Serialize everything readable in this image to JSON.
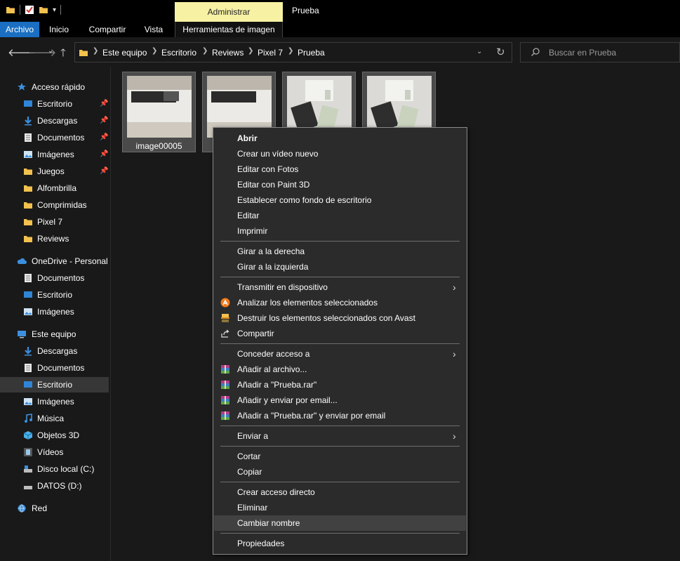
{
  "window": {
    "title": "Prueba",
    "contextual_tab": "Administrar"
  },
  "ribbon": {
    "tabs": [
      "Archivo",
      "Inicio",
      "Compartir",
      "Vista",
      "Herramientas de imagen"
    ]
  },
  "address": {
    "crumbs": [
      "Este equipo",
      "Escritorio",
      "Reviews",
      "Pixel 7",
      "Prueba"
    ]
  },
  "search": {
    "placeholder": "Buscar en Prueba"
  },
  "sidebar": {
    "quick_access": "Acceso rápido",
    "quick_items": [
      "Escritorio",
      "Descargas",
      "Documentos",
      "Imágenes",
      "Juegos",
      "Alfombrilla",
      "Comprimidas",
      "Pixel 7",
      "Reviews"
    ],
    "onedrive": "OneDrive - Personal",
    "onedrive_items": [
      "Documentos",
      "Escritorio",
      "Imágenes"
    ],
    "this_pc": "Este equipo",
    "pc_items": [
      "Descargas",
      "Documentos",
      "Escritorio",
      "Imágenes",
      "Música",
      "Objetos 3D",
      "Vídeos",
      "Disco local (C:)",
      "DATOS (D:)"
    ],
    "network": "Red"
  },
  "files": [
    {
      "name": "image00005"
    }
  ],
  "context_menu": {
    "items": [
      "Abrir",
      "Crear un vídeo nuevo",
      "Editar con Fotos",
      "Editar con Paint 3D",
      "Establecer como fondo de escritorio",
      "Editar",
      "Imprimir",
      "Girar a la derecha",
      "Girar a la izquierda",
      "Transmitir en dispositivo",
      "Analizar los elementos seleccionados",
      "Destruir los elementos seleccionados con Avast",
      "Compartir",
      "Conceder acceso a",
      "Añadir al archivo...",
      "Añadir a \"Prueba.rar\"",
      "Añadir y enviar por email...",
      "Añadir a \"Prueba.rar\" y enviar por email",
      "Enviar a",
      "Cortar",
      "Copiar",
      "Crear acceso directo",
      "Eliminar",
      "Cambiar nombre",
      "Propiedades"
    ],
    "highlighted": "Cambiar nombre"
  },
  "colors": {
    "file_tab": "#1a6fc2",
    "contextual_tab": "#f7f1a4",
    "folder": "#f2c14e",
    "menu_bg": "#2b2b2b",
    "selected": "#373737"
  }
}
